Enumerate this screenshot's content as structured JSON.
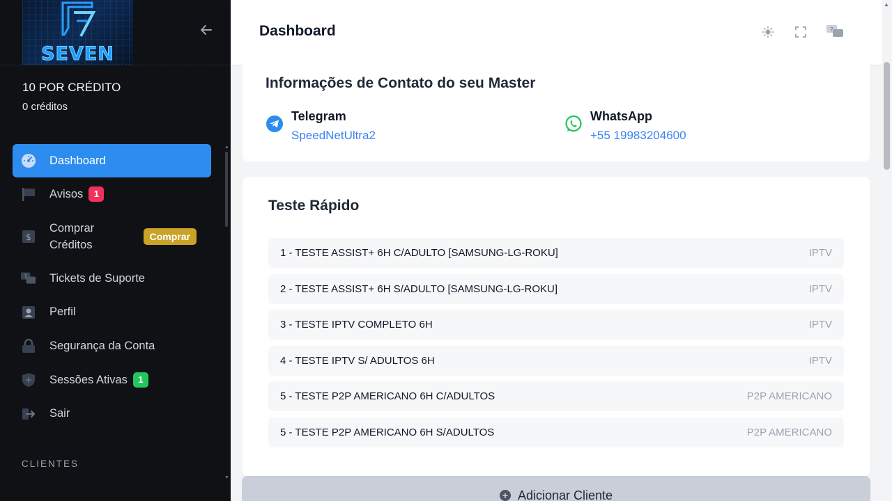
{
  "brand": {
    "logo_text": "SEVEN"
  },
  "sidebar": {
    "plan_title": "10 POR CRÉDITO",
    "credits": "0 créditos",
    "items": [
      {
        "label": "Dashboard",
        "icon": "speedometer-icon",
        "active": true
      },
      {
        "label": "Avisos",
        "icon": "flag-icon",
        "badge": "1"
      },
      {
        "label_line1": "Comprar",
        "label_line2": "Créditos",
        "icon": "dollar-icon",
        "action": "Comprar"
      },
      {
        "label": "Tickets de Suporte",
        "icon": "chat-bubbles-icon"
      },
      {
        "label": "Perfil",
        "icon": "user-icon"
      },
      {
        "label": "Segurança da Conta",
        "icon": "lock-icon"
      },
      {
        "label": "Sessões Ativas",
        "icon": "shield-icon",
        "badge": "1"
      },
      {
        "label": "Sair",
        "icon": "logout-icon"
      }
    ],
    "section_label": "CLIENTES"
  },
  "header": {
    "title": "Dashboard"
  },
  "contact": {
    "title": "Informações de Contato do seu Master",
    "telegram": {
      "name": "Telegram",
      "value": "SpeedNetUltra2"
    },
    "whatsapp": {
      "name": "WhatsApp",
      "value": "+55 19983204600"
    }
  },
  "quick_test": {
    "title": "Teste Rápido",
    "rows": [
      {
        "name": "1 - TESTE ASSIST+ 6H C/ADULTO [SAMSUNG-LG-ROKU]",
        "type": "IPTV"
      },
      {
        "name": "2 - TESTE ASSIST+ 6H S/ADULTO [SAMSUNG-LG-ROKU]",
        "type": "IPTV"
      },
      {
        "name": "3 - TESTE IPTV COMPLETO 6H",
        "type": "IPTV"
      },
      {
        "name": "4 - TESTE IPTV S/ ADULTOS 6H",
        "type": "IPTV"
      },
      {
        "name": "5 - TESTE P2P AMERICANO 6H C/ADULTOS",
        "type": "P2P AMERICANO"
      },
      {
        "name": "5 - TESTE P2P AMERICANO 6H S/ADULTOS",
        "type": "P2P AMERICANO"
      }
    ]
  },
  "add_client": {
    "label": "Adicionar Cliente"
  },
  "colors": {
    "accent": "#2d8cf0",
    "sidebar_bg": "#0f1115",
    "buy_badge": "#c9a227",
    "danger": "#f0325a",
    "success": "#22c55e"
  }
}
